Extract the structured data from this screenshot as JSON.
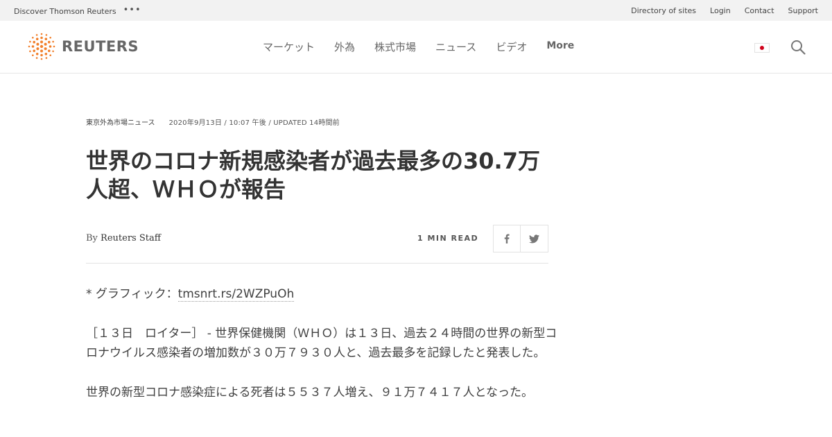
{
  "topbar": {
    "discover": "Discover Thomson Reuters",
    "dots": "•••",
    "links": [
      "Directory of sites",
      "Login",
      "Contact",
      "Support"
    ]
  },
  "header": {
    "brand": "REUTERS",
    "nav": [
      "マーケット",
      "外為",
      "株式市場",
      "ニュース",
      "ビデオ"
    ],
    "more": "More"
  },
  "article": {
    "section": "東京外為市場ニュース",
    "dateline": "2020年9月13日 / 10:07 午後 / UPDATED 14時間前",
    "headline": "世界のコロナ新規感染者が過去最多の30.7万人超、ＷＨＯが報告",
    "byline_prefix": "By",
    "author": "Reuters Staff",
    "read_time": "1 MIN READ",
    "para1_prefix": "* グラフィック：",
    "para1_link": "tmsnrt.rs/2WZPuOh",
    "para2": "［１３日　ロイター］ - 世界保健機関（ＷＨＯ）は１３日、過去２４時間の世界の新型コロナウイルス感染者の増加数が３０万７９３０人と、過去最多を記録したと発表した。",
    "para3": "世界の新型コロナ感染症による死者は５５３７人増え、９１万７４１７人となった。"
  },
  "colors": {
    "brand_orange": "#f2802c",
    "flag_red": "#d0021b"
  },
  "icons": [
    "reuters-logo-icon",
    "japan-flag-icon",
    "search-icon",
    "facebook-icon",
    "twitter-icon"
  ]
}
